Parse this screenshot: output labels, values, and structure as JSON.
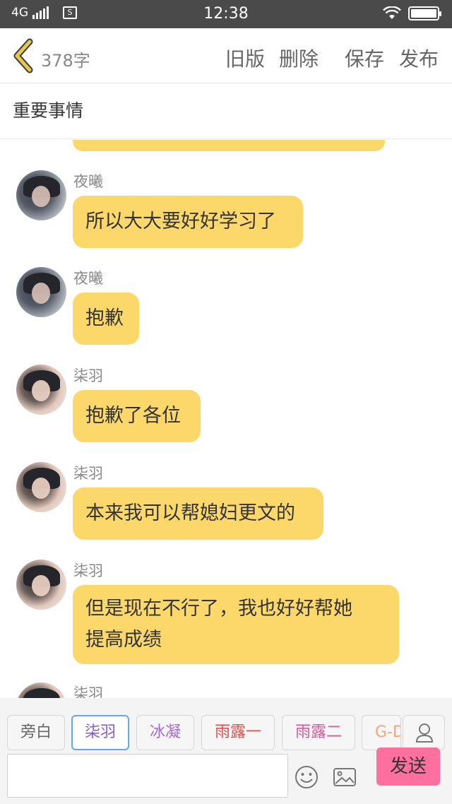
{
  "status_bar": {
    "network": "4G",
    "time": "12:38"
  },
  "toolbar": {
    "char_count": "378字",
    "old_version": "旧版",
    "delete": "删除",
    "save": "保存",
    "publish": "发布"
  },
  "title": "重要事情",
  "messages": [
    {
      "sender": "夜曦",
      "lines": [
        "所以大大要好好学习了"
      ],
      "avatar": "avatar-yexi"
    },
    {
      "sender": "夜曦",
      "lines": [
        "抱歉"
      ],
      "avatar": "avatar-yexi"
    },
    {
      "sender": "柒羽",
      "lines": [
        "抱歉了各位"
      ],
      "avatar": "avatar-qiyu"
    },
    {
      "sender": "柒羽",
      "lines": [
        "本来我可以帮媳妇更文的"
      ],
      "avatar": "avatar-qiyu"
    },
    {
      "sender": "柒羽",
      "lines": [
        "但是现在不行了，我也好好帮她",
        "提高成绩"
      ],
      "avatar": "avatar-qiyu"
    },
    {
      "sender": "柒羽",
      "lines": [],
      "avatar": "avatar-qiyu"
    }
  ],
  "roles": [
    {
      "label": "旁白",
      "color": "#666666",
      "selected": false
    },
    {
      "label": "柒羽",
      "color": "#8b5bd6",
      "selected": true
    },
    {
      "label": "冰凝",
      "color": "#a66ad6",
      "selected": false
    },
    {
      "label": "雨露一",
      "color": "#d9534f",
      "selected": false
    },
    {
      "label": "雨露二",
      "color": "#d45a9a",
      "selected": false
    },
    {
      "label": "G-D",
      "color": "#f0a87a",
      "selected": false
    }
  ],
  "input": {
    "value": "",
    "placeholder": ""
  },
  "send_label": "发送",
  "colors": {
    "bubble": "#fcd86b",
    "send_button": "#ff6fa0",
    "status_bar": "#4a4a4a",
    "back_arrow": "#e7c84a"
  }
}
